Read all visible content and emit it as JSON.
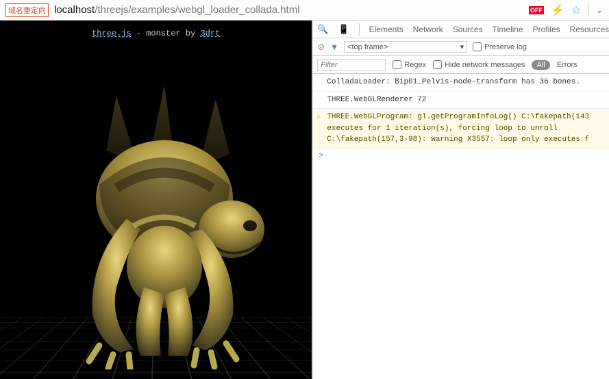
{
  "addressBar": {
    "badge": "域名重定向",
    "urlDomain": "localhost",
    "urlPath": "/threejs/examples/webgl_loader_collada.html",
    "offLabel": "OFF"
  },
  "viewport": {
    "link1": "three.js",
    "middle": " - monster by ",
    "link2": "3drt"
  },
  "devtools": {
    "tabs": [
      "Elements",
      "Network",
      "Sources",
      "Timeline",
      "Profiles",
      "Resources"
    ],
    "frameSelect": "<top frame>",
    "preserveLog": "Preserve log",
    "filterPlaceholder": "Filter",
    "regex": "Regex",
    "hideNetwork": "Hide network messages",
    "pillAll": "All",
    "errors": "Errors",
    "logs": [
      {
        "type": "log",
        "text": "ColladaLoader: Bip01_Pelvis-node-transform has 36 bones."
      },
      {
        "type": "log",
        "text": "THREE.WebGLRenderer 72"
      },
      {
        "type": "warn",
        "text": "THREE.WebGLProgram: gl.getProgramInfoLog() C:\\fakepath(143\nexecutes for 1 iteration(s), forcing loop to unroll\nC:\\fakepath(157,3-98): warning X3557: loop only executes f"
      }
    ],
    "promptSymbol": ">"
  }
}
